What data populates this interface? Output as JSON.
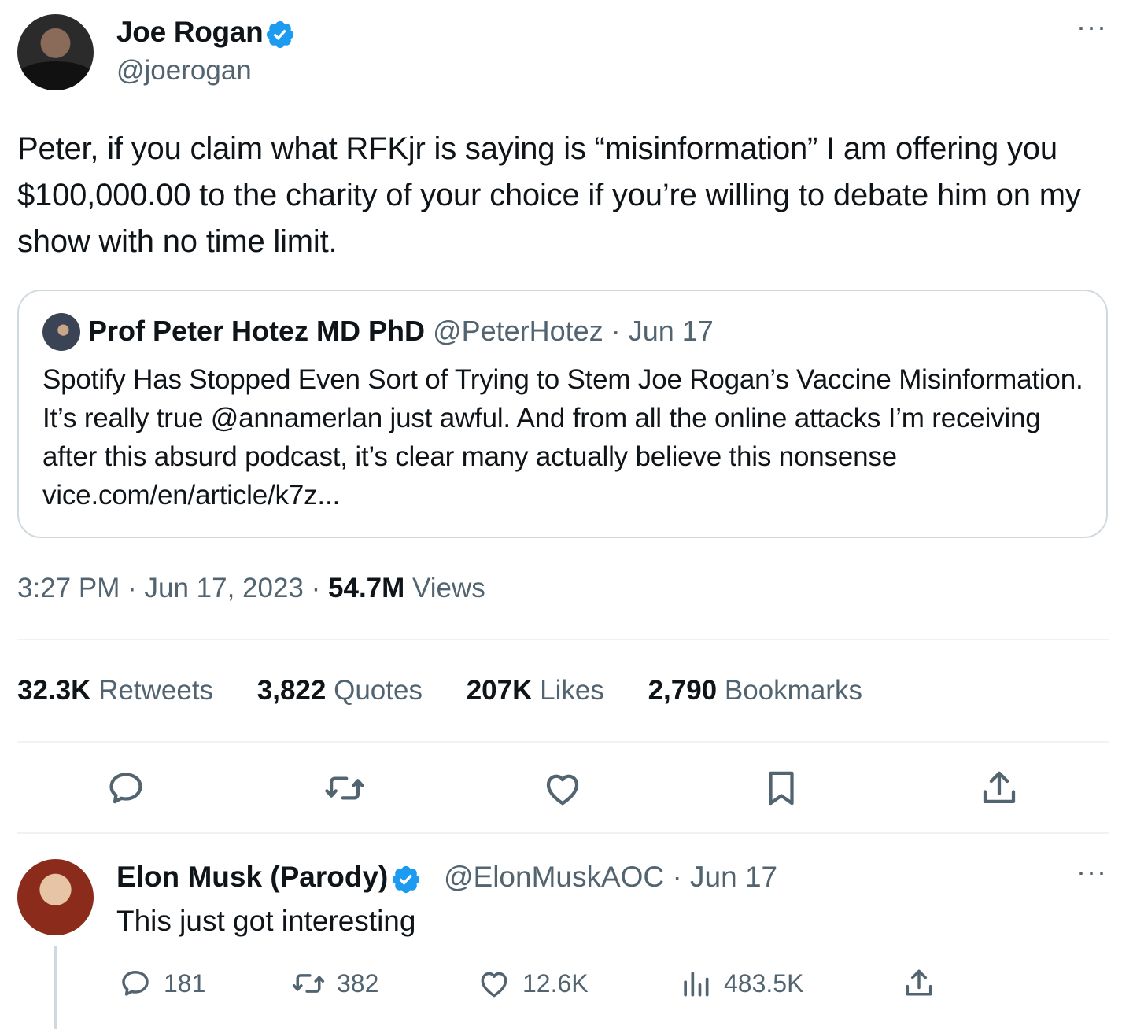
{
  "main_tweet": {
    "author_name": "Joe Rogan",
    "author_handle": "@joerogan",
    "more_label": "···",
    "text": "Peter, if you claim what RFKjr is saying is “misinformation” I am offering you $100,000.00 to the charity of your choice if you’re willing to debate him on my show with no time limit.",
    "time": "3:27 PM",
    "date": "Jun 17, 2023",
    "separator": "·",
    "views_count": "54.7M",
    "views_label": "Views"
  },
  "quoted_tweet": {
    "author_name": "Prof Peter Hotez MD PhD",
    "author_handle": "@PeterHotez",
    "date": "Jun 17",
    "text": "Spotify Has Stopped Even Sort of Trying to Stem Joe Rogan’s Vaccine Misinformation. It’s really true @annamerlan just awful. And from all the online attacks I’m receiving after this absurd podcast, it’s clear many actually believe this nonsense vice.com/en/article/k7z..."
  },
  "stats": [
    {
      "count": "32.3K",
      "label": "Retweets"
    },
    {
      "count": "3,822",
      "label": "Quotes"
    },
    {
      "count": "207K",
      "label": "Likes"
    },
    {
      "count": "2,790",
      "label": "Bookmarks"
    }
  ],
  "actions": [
    "reply-icon",
    "retweet-icon",
    "like-icon",
    "bookmark-icon",
    "share-icon"
  ],
  "reply": {
    "author_name": "Elon Musk (Parody)",
    "author_handle": "@ElonMuskAOC",
    "date": "Jun 17",
    "text": "This just got interesting",
    "more_label": "···",
    "replies": "181",
    "retweets": "382",
    "likes": "12.6K",
    "views": "483.5K"
  },
  "colors": {
    "verified": "#1d9bf0",
    "secondary_text": "#536471",
    "primary_text": "#0f1419",
    "border": "#cfd9de"
  }
}
